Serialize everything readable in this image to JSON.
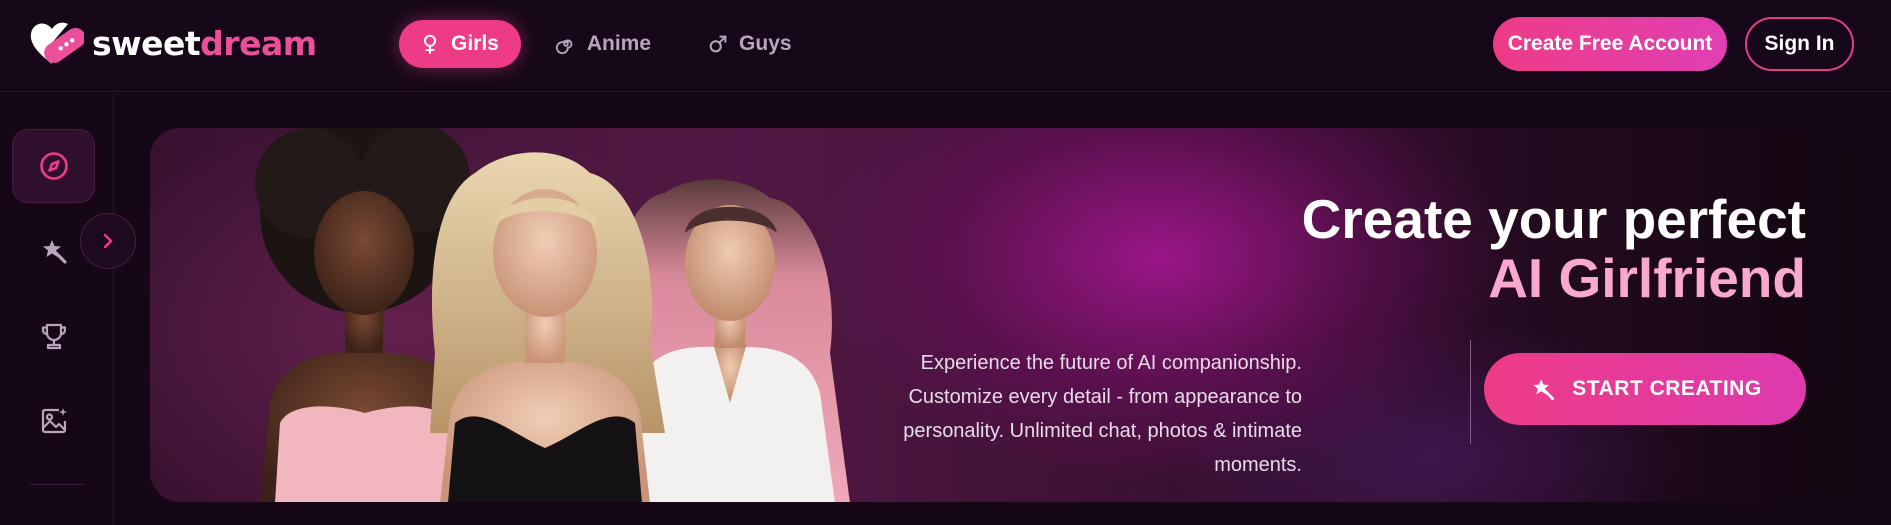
{
  "brand": {
    "name_part1": "sweet",
    "name_part2": "dream"
  },
  "nav": {
    "tabs": [
      {
        "label": "Girls",
        "icon": "female-icon",
        "active": true
      },
      {
        "label": "Anime",
        "icon": "spiral-icon",
        "active": false
      },
      {
        "label": "Guys",
        "icon": "male-icon",
        "active": false
      }
    ]
  },
  "header": {
    "create_account_label": "Create Free Account",
    "sign_in_label": "Sign In"
  },
  "sidebar": {
    "items": [
      {
        "icon": "compass-icon",
        "active": true
      },
      {
        "icon": "magic-wand-icon",
        "active": false
      },
      {
        "icon": "trophy-icon",
        "active": false
      },
      {
        "icon": "image-sparkle-icon",
        "active": false
      }
    ],
    "expand_icon": "chevron-right-icon"
  },
  "hero": {
    "title_line1": "Create your perfect",
    "title_line2": "AI Girlfriend",
    "description": "Experience the future of AI companionship. Customize every detail - from appearance to personality. Unlimited chat, photos & intimate moments.",
    "cta_label": "START CREATING",
    "cta_icon": "magic-wand-icon"
  },
  "colors": {
    "accent": "#ee3b86",
    "accent_light": "#f9a8cf",
    "background": "#150716"
  }
}
